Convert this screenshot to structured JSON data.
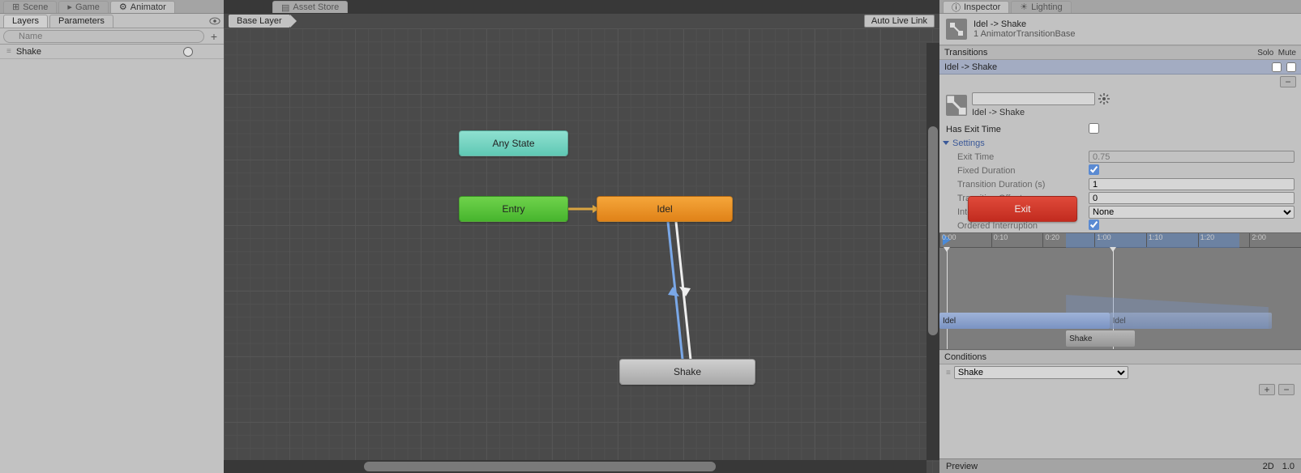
{
  "topTabs": {
    "scene": "Scene",
    "game": "Game",
    "animator": "Animator",
    "assetStore": "Asset Store",
    "inspector": "Inspector",
    "lighting": "Lighting"
  },
  "left": {
    "subtabs": {
      "layers": "Layers",
      "parameters": "Parameters"
    },
    "searchPlaceholder": "Name",
    "params": [
      {
        "name": "Shake"
      }
    ]
  },
  "canvas": {
    "breadcrumb": "Base Layer",
    "autoLive": "Auto Live Link",
    "nodes": {
      "any": "Any State",
      "entry": "Entry",
      "idel": "Idel",
      "exit": "Exit",
      "shake": "Shake"
    }
  },
  "inspector": {
    "title": "Idel -> Shake",
    "subtitle": "1 AnimatorTransitionBase",
    "transitionsHeader": "Transitions",
    "soloLabel": "Solo",
    "muteLabel": "Mute",
    "transitionItem": "Idel -> Shake",
    "nameField": "",
    "nameSubtitle": "Idel -> Shake",
    "hasExitTime": {
      "label": "Has Exit Time",
      "value": false
    },
    "settingsLabel": "Settings",
    "exitTime": {
      "label": "Exit Time",
      "value": "0.75"
    },
    "fixedDuration": {
      "label": "Fixed Duration",
      "value": true
    },
    "transitionDuration": {
      "label": "Transition Duration (s)",
      "value": "1"
    },
    "transitionOffset": {
      "label": "Transition Offset",
      "value": "0"
    },
    "interruptionSource": {
      "label": "Interruption Source",
      "value": "None"
    },
    "orderedInterruption": {
      "label": "Ordered Interruption",
      "value": true
    },
    "timeline": {
      "ticks": [
        "0:00",
        "0:10",
        "0:20",
        "1:00",
        "1:10",
        "1:20",
        "2:00"
      ],
      "barA": "Idel",
      "barA2": "Idel",
      "barB": "Shake"
    },
    "conditions": {
      "header": "Conditions",
      "item": "Shake"
    },
    "preview": {
      "label": "Preview",
      "mode": "2D",
      "value": "1.0"
    }
  }
}
